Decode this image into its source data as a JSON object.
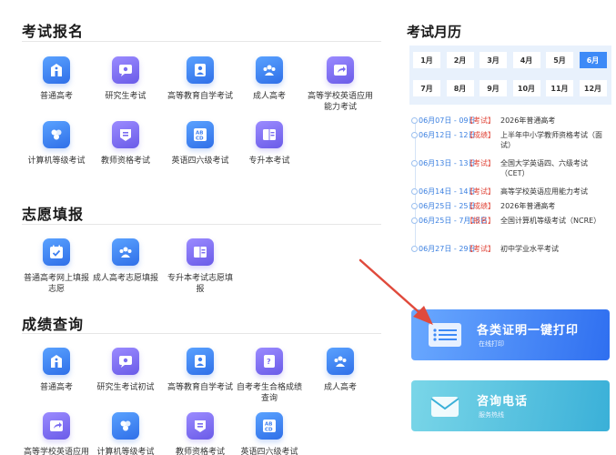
{
  "sections": {
    "registration": {
      "title": "考试报名",
      "items": [
        {
          "label": "普通高考",
          "icon": "school-building-icon"
        },
        {
          "label": "研究生考试",
          "icon": "graduate-chat-icon"
        },
        {
          "label": "高等教育自学考试",
          "icon": "portrait-id-icon"
        },
        {
          "label": "成人高考",
          "icon": "people-group-icon"
        },
        {
          "label": "高等学校英语应用能力考试",
          "icon": "share-arrow-icon"
        },
        {
          "label": "计算机等级考试",
          "icon": "hexagon-cluster-icon"
        },
        {
          "label": "教师资格考试",
          "icon": "teacher-badge-icon"
        },
        {
          "label": "英语四六级考试",
          "icon": "abcd-letters-icon"
        },
        {
          "label": "专升本考试",
          "icon": "book-open-icon"
        }
      ]
    },
    "volunteer": {
      "title": "志愿填报",
      "items": [
        {
          "label": "普通高考网上填报志愿",
          "icon": "calendar-check-icon"
        },
        {
          "label": "成人高考志愿填报",
          "icon": "people-group-icon"
        },
        {
          "label": "专升本考试志愿填报",
          "icon": "book-open-icon"
        }
      ]
    },
    "scores": {
      "title": "成绩查询",
      "items": [
        {
          "label": "普通高考",
          "icon": "school-building-icon"
        },
        {
          "label": "研究生考试初试",
          "icon": "graduate-chat-icon"
        },
        {
          "label": "高等教育自学考试",
          "icon": "portrait-id-icon"
        },
        {
          "label": "自考考生合格成绩查询",
          "icon": "question-document-icon"
        },
        {
          "label": "成人高考",
          "icon": "people-group-icon"
        },
        {
          "label": "高等学校英语应用",
          "icon": "share-arrow-icon"
        },
        {
          "label": "计算机等级考试",
          "icon": "hexagon-cluster-icon"
        },
        {
          "label": "教师资格考试",
          "icon": "teacher-badge-icon"
        },
        {
          "label": "英语四六级考试",
          "icon": "abcd-letters-icon"
        }
      ]
    }
  },
  "calendar": {
    "title": "考试月历",
    "months": [
      "1月",
      "2月",
      "3月",
      "4月",
      "5月",
      "6月",
      "7月",
      "8月",
      "9月",
      "10月",
      "11月",
      "12月"
    ],
    "active_month": "6月",
    "events": [
      {
        "date": "06月07日 - 09日",
        "tag": "【考试】",
        "tag_color": "#e0463a",
        "text": "2026年普通高考"
      },
      {
        "date": "06月12日 - 12日",
        "tag": "【成绩】",
        "tag_color": "#e0463a",
        "text": "上半年中小学教师资格考试（面试）"
      },
      {
        "date": "06月13日 - 13日",
        "tag": "【考试】",
        "tag_color": "#e0463a",
        "text": "全国大学英语四、六级考试（CET）"
      },
      {
        "date": "06月14日 - 14日",
        "tag": "【考试】",
        "tag_color": "#e0463a",
        "text": "高等学校英语应用能力考试"
      },
      {
        "date": "06月25日 - 25日",
        "tag": "【成绩】",
        "tag_color": "#e0463a",
        "text": "2026年普通高考"
      },
      {
        "date": "06月25日 - 7月15日",
        "tag": "【报名】",
        "tag_color": "#e0463a",
        "text": "全国计算机等级考试（NCRE）"
      },
      {
        "date": "06月27日 - 29日",
        "tag": "【考试】",
        "tag_color": "#e0463a",
        "text": "初中学业水平考试"
      }
    ]
  },
  "banners": {
    "print": {
      "title": "各类证明一键打印",
      "subtitle": "在线打印",
      "icon": "document-lines-icon"
    },
    "hotline": {
      "title": "咨询电话",
      "subtitle": "服务热线",
      "icon": "envelope-icon"
    }
  },
  "colors": {
    "accent": "#3d8af7",
    "tag_red": "#e0463a",
    "date_blue": "#3a7fe0"
  }
}
